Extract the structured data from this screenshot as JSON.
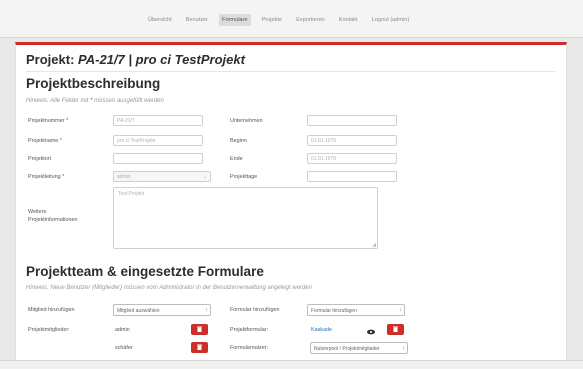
{
  "nav": {
    "items": [
      "Übersicht",
      "Benutzer",
      "Formulare",
      "Projekte",
      "Exportieren",
      "Kontakt",
      "Logout (admin)"
    ],
    "active": "Formulare"
  },
  "page": {
    "title_prefix": "Projekt: ",
    "title_project": "PA-21/7 | pro ci TestProjekt"
  },
  "description": {
    "heading": "Projektbeschreibung",
    "hint_before": "Hinweis: Alle Felder mit ",
    "hint_star": "*",
    "hint_after": " müssen ausgefüllt werden",
    "fields": {
      "projektnummer": {
        "label": "Projektnummer",
        "required": "*",
        "value": "PA-21/7"
      },
      "projektname": {
        "label": "Projektname",
        "required": "*",
        "value": "pro ci TestProjekt"
      },
      "projektort": {
        "label": "Projektort",
        "value": ""
      },
      "projektleitung": {
        "label": "Projektleitung",
        "required": "*",
        "value": "admin"
      },
      "unternehmen": {
        "label": "Unternehmen",
        "value": ""
      },
      "beginn": {
        "label": "Beginn",
        "value": "01.01.1970"
      },
      "ende": {
        "label": "Ende",
        "value": "01.01.1970"
      },
      "projekttage": {
        "label": "Projekttage",
        "value": ""
      },
      "weitere": {
        "label_line1": "Weitere",
        "label_line2": "Projektinformationen",
        "value": "Test Projekt"
      }
    }
  },
  "team": {
    "heading": "Projektteam & eingesetzte Formulare",
    "hint": "Hinweis: Neue Benutzer (Mitglieder) müssen vom Administrator in der Benutzerverwaltung angelegt werden",
    "mitglied_label": "Mitglied hinzufügen",
    "mitglied_select": "Mitglied auswählen",
    "formular_label": "Formular hinzufügen",
    "formular_select": "Formular hinzufügen",
    "projektmitglieder_label": "Projektmitglieder:",
    "members": [
      "admin",
      "schäfer"
    ],
    "projektformular_label": "Projektformular:",
    "projektformular_link": "Kaskade",
    "formularnutzer_label": "Formularnutzer:",
    "formularnutzer_select": "Nutzerpool / Projektmitglieder"
  },
  "colors": {
    "accent": "#c9302c",
    "link": "#2a6ebb",
    "background": "#e9e9e9"
  }
}
